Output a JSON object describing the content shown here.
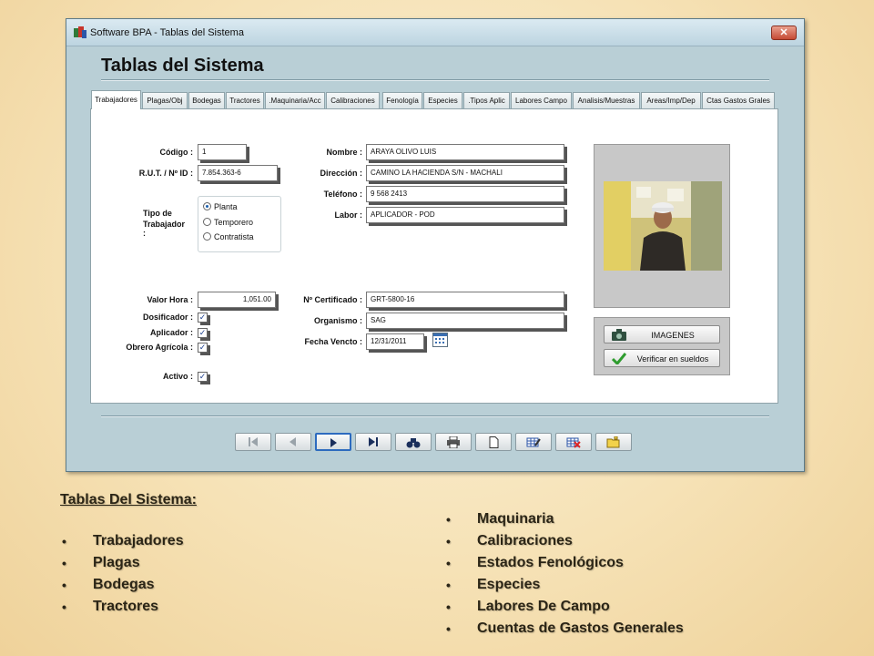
{
  "window": {
    "title": "Software BPA - Tablas del Sistema",
    "close_label": "✕",
    "heading": "Tablas del Sistema"
  },
  "tabs": [
    {
      "label": "Trabajadores",
      "active": true
    },
    {
      "label": "Plagas/Obj"
    },
    {
      "label": "Bodegas"
    },
    {
      "label": "Tractores"
    },
    {
      "label": ".Maquinaria/Acc"
    },
    {
      "label": "Calibraciones"
    },
    {
      "label": "Fenología"
    },
    {
      "label": "Especies"
    },
    {
      "label": ".Tipos Aplic"
    },
    {
      "label": "Labores Campo"
    },
    {
      "label": "Analisis/Muestras"
    },
    {
      "label": "Areas/Imp/Dep"
    },
    {
      "label": "Ctas Gastos Grales"
    }
  ],
  "form": {
    "codigo": {
      "label": "Código :",
      "value": "1"
    },
    "rut": {
      "label": "R.U.T. / Nº ID :",
      "value": "7.854.363-6"
    },
    "tipo_trabajador": {
      "label_line1": "Tipo de",
      "label_line2": "Trabajador :",
      "options": [
        "Planta",
        "Temporero",
        "Contratista"
      ],
      "selected": "Planta"
    },
    "valor_hora": {
      "label": "Valor Hora :",
      "value": "1,051.00"
    },
    "dosificador": {
      "label": "Dosificador :",
      "checked": true
    },
    "aplicador": {
      "label": "Aplicador :",
      "checked": true
    },
    "obrero": {
      "label": "Obrero Agrícola :",
      "checked": true
    },
    "activo": {
      "label": "Activo :",
      "checked": true
    },
    "nombre": {
      "label": "Nombre :",
      "value": "ARAYA OLIVO LUIS"
    },
    "direccion": {
      "label": "Dirección :",
      "value": "CAMINO LA HACIENDA S/N - MACHALI"
    },
    "telefono": {
      "label": "Teléfono :",
      "value": "9 568 2413"
    },
    "labor": {
      "label": "Labor :",
      "value": "APLICADOR - POD"
    },
    "certificado": {
      "label": "Nº Certificado :",
      "value": "GRT-5800-16"
    },
    "organismo": {
      "label": "Organismo :",
      "value": "SAG"
    },
    "fecha_vencto": {
      "label": "Fecha Vencto :",
      "value": "12/31/2011"
    }
  },
  "side_buttons": {
    "imagenes": "IMAGENES",
    "verificar": "Verificar en sueldos"
  },
  "nav_buttons": [
    "first",
    "prev",
    "next",
    "last",
    "search",
    "print",
    "new",
    "edit",
    "delete",
    "folder"
  ],
  "notes": {
    "title": "Tablas Del Sistema:",
    "left": [
      "Trabajadores",
      "Plagas",
      "Bodegas",
      "Tractores"
    ],
    "right": [
      "Maquinaria",
      "Calibraciones",
      "Estados Fenológicos",
      "Especies",
      "Labores De Campo",
      "Cuentas de Gastos Generales"
    ],
    "bullet": "•"
  },
  "colors": {
    "window_bg": "#b9cfd6",
    "accent": "#2d6bbf",
    "text": "#2b2516"
  }
}
